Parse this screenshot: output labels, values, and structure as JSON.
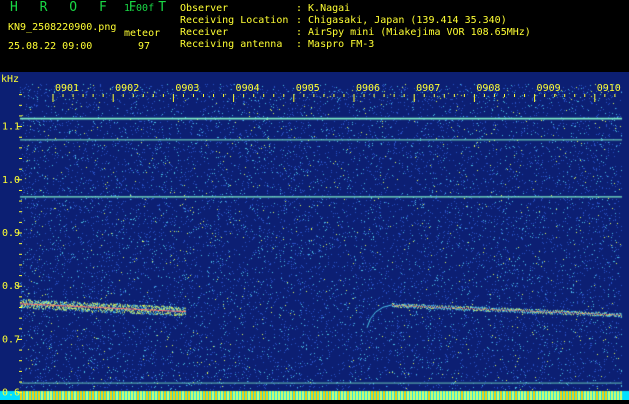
{
  "header": {
    "app_name": "H R O F F T",
    "version": "1.00f",
    "filename": "KN9_2508220900.png",
    "datetime": "25.08.22 09:00",
    "mode_label": "meteor",
    "mode_value": "97",
    "meta": [
      {
        "label": "Observer",
        "value": ": K.Nagai"
      },
      {
        "label": "Receiving Location",
        "value": ": Chigasaki, Japan (139.414 35.340)"
      },
      {
        "label": "Receiver",
        "value": ": AirSpy mini (Miakejima VOR 108.65MHz)"
      },
      {
        "label": "Receiving antenna",
        "value": ": Maspro FM-3"
      }
    ]
  },
  "plot": {
    "y_unit": "kHz",
    "y_ticks": [
      {
        "label": "1.1",
        "value": 1.1
      },
      {
        "label": "1.0",
        "value": 1.0
      },
      {
        "label": "0.9",
        "value": 0.9
      },
      {
        "label": "0.8",
        "value": 0.8
      },
      {
        "label": "0.7",
        "value": 0.7
      },
      {
        "label": "0.6",
        "value": 0.6
      }
    ],
    "x_ticks": [
      "0901",
      "0902",
      "0903",
      "0904",
      "0905",
      "0906",
      "0907",
      "0908",
      "0909",
      "0910"
    ],
    "colors": {
      "background": "#0c1f73",
      "noise_low": "#2a53c8",
      "noise_mid": "#4bc3e8",
      "noise_high": "#e0ff60",
      "carrier": "#7ef0c8",
      "echo": "#ff7070",
      "label": "#ffff33",
      "bottom_bar": "#00e0ff"
    }
  }
}
